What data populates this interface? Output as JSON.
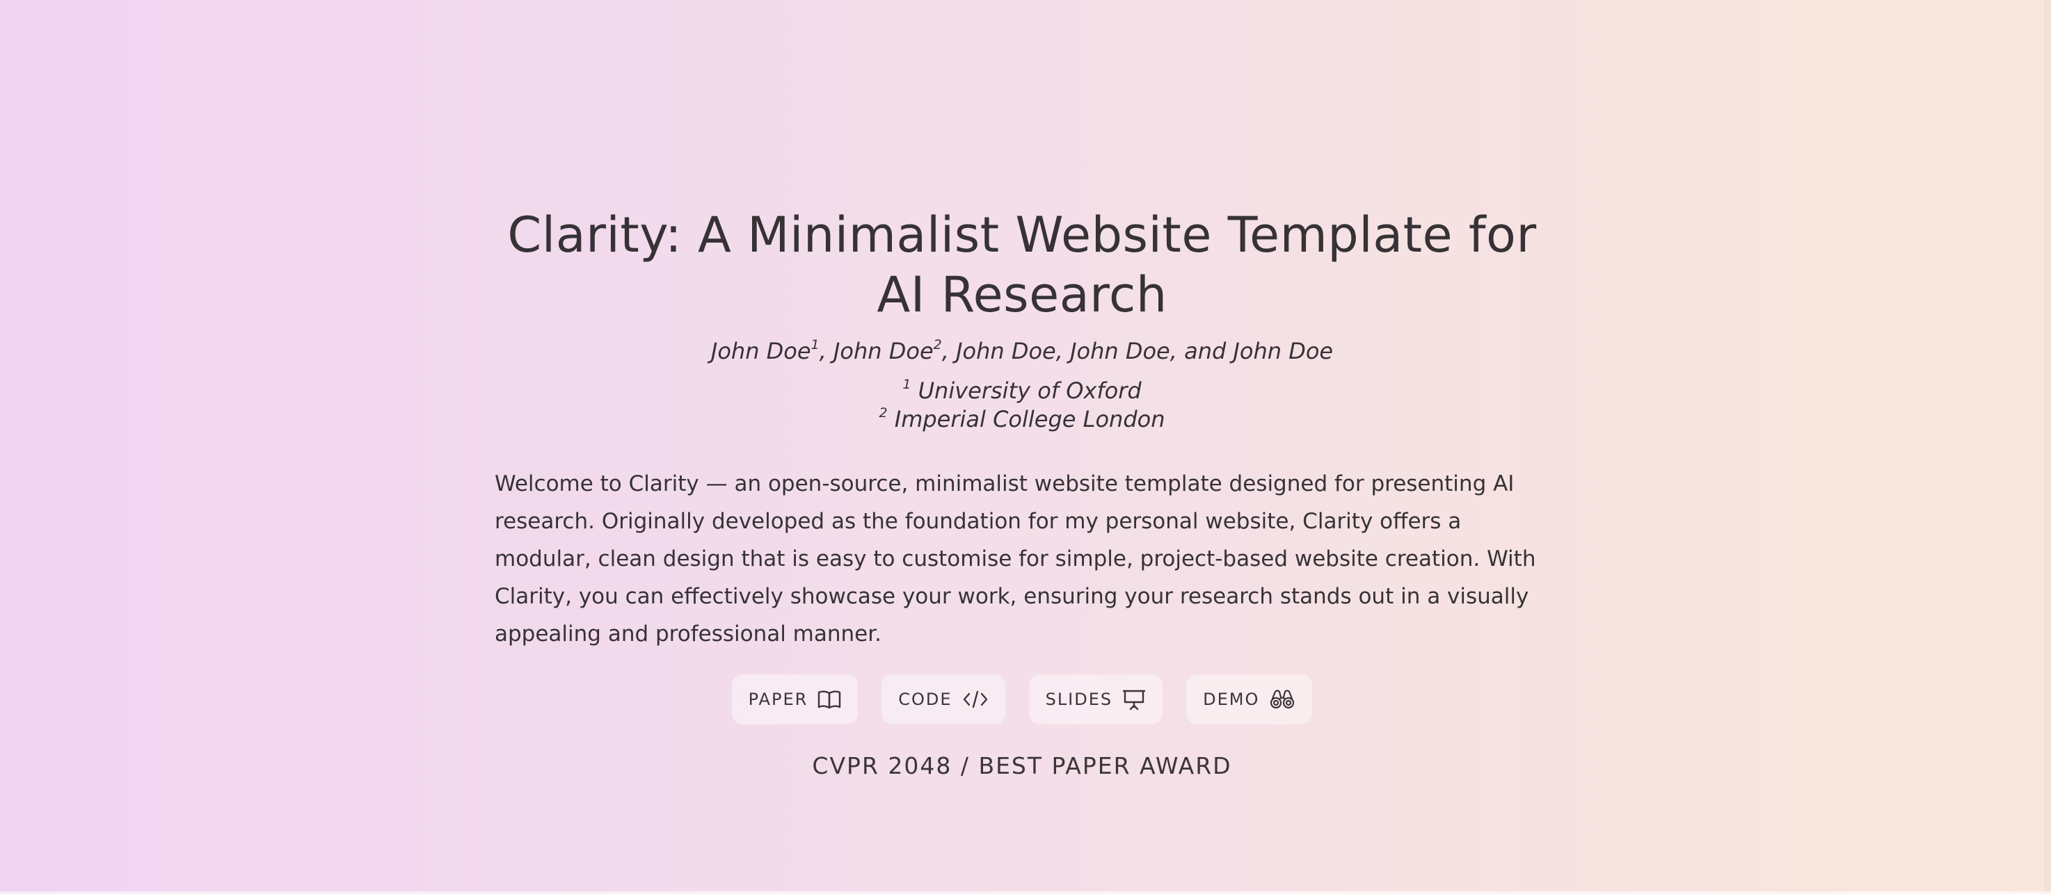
{
  "hero": {
    "title": "Clarity: A Minimalist Website Template for AI Research",
    "authors": [
      {
        "name": "John Doe",
        "sup": "1",
        "sep": ", "
      },
      {
        "name": "John Doe",
        "sup": "2",
        "sep": ", "
      },
      {
        "name": "John Doe",
        "sup": "",
        "sep": ", "
      },
      {
        "name": "John Doe",
        "sup": "",
        "sep": ", and "
      },
      {
        "name": "John Doe",
        "sup": "",
        "sep": ""
      }
    ],
    "affiliations": [
      {
        "sup": "1",
        "name": "University of Oxford"
      },
      {
        "sup": "2",
        "name": "Imperial College London"
      }
    ],
    "abstract": "Welcome to Clarity — an open-source, minimalist website template designed for presenting AI research. Originally developed as the foundation for my personal website, Clarity offers a modular, clean design that is easy to customise for simple, project-based website creation. With Clarity, you can effectively showcase your work, ensuring your research stands out in a visually appealing and professional manner.",
    "links": [
      {
        "label": "PAPER",
        "icon": "book-open-icon"
      },
      {
        "label": "CODE",
        "icon": "code-icon"
      },
      {
        "label": "SLIDES",
        "icon": "presentation-icon"
      },
      {
        "label": "DEMO",
        "icon": "binoculars-icon"
      }
    ],
    "award": "CVPR 2048 / BEST PAPER AWARD"
  },
  "colors": {
    "text": "#363236",
    "gradient_left": "#f0d4f1",
    "gradient_right": "#f9e7dc",
    "button_bg": "rgba(255,255,255,0.42)"
  }
}
